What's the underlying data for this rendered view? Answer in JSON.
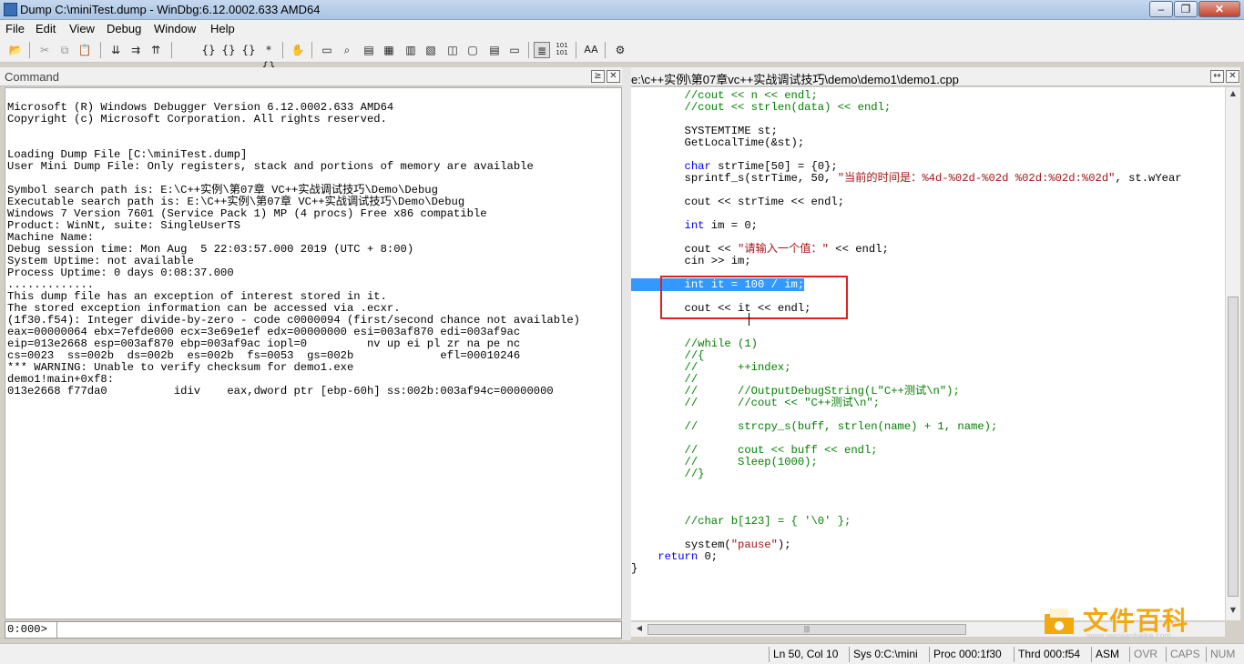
{
  "window": {
    "title": "Dump C:\\miniTest.dump - WinDbg:6.12.0002.633 AMD64",
    "min": "–",
    "max": "❐",
    "close": "✕"
  },
  "menu": [
    "File",
    "Edit",
    "View",
    "Debug",
    "Window",
    "Help"
  ],
  "toolbar": {
    "icons": [
      "open-icon",
      "cut-icon",
      "copy-icon",
      "paste-icon",
      "step-into-icon",
      "step-over-icon",
      "step-out-icon",
      "run-to-cursor-icon",
      "breakpoint-icon",
      "hand-icon",
      "command-window-icon",
      "watch-window-icon",
      "locals-window-icon",
      "registers-window-icon",
      "memory-window-icon",
      "call-stack-icon",
      "disassembly-icon",
      "scratch-pad-icon",
      "source-mode-icon",
      "hex-mode-icon",
      "font-icon",
      "options-icon"
    ],
    "hex_label": "101\n101",
    "font_label": "AA"
  },
  "command_pane": {
    "title": "Command",
    "lines": [
      "",
      "Microsoft (R) Windows Debugger Version 6.12.0002.633 AMD64",
      "Copyright (c) Microsoft Corporation. All rights reserved.",
      "",
      "",
      "Loading Dump File [C:\\miniTest.dump]",
      "User Mini Dump File: Only registers, stack and portions of memory are available",
      "",
      "Symbol search path is: E:\\C++实例\\第07章 VC++实战调试技巧\\Demo\\Debug",
      "Executable search path is: E:\\C++实例\\第07章 VC++实战调试技巧\\Demo\\Debug",
      "Windows 7 Version 7601 (Service Pack 1) MP (4 procs) Free x86 compatible",
      "Product: WinNt, suite: SingleUserTS",
      "Machine Name:",
      "Debug session time: Mon Aug  5 22:03:57.000 2019 (UTC + 8:00)",
      "System Uptime: not available",
      "Process Uptime: 0 days 0:08:37.000",
      ".............",
      "This dump file has an exception of interest stored in it.",
      "The stored exception information can be accessed via .ecxr.",
      "(1f30.f54): Integer divide-by-zero - code c0000094 (first/second chance not available)",
      "eax=00000064 ebx=7efde000 ecx=3e69e1ef edx=00000000 esi=003af870 edi=003af9ac",
      "eip=013e2668 esp=003af870 ebp=003af9ac iopl=0         nv up ei pl zr na pe nc",
      "cs=0023  ss=002b  ds=002b  es=002b  fs=0053  gs=002b             efl=00010246",
      "*** WARNING: Unable to verify checksum for demo1.exe",
      "demo1!main+0xf8:",
      "013e2668 f77da0          idiv    eax,dword ptr [ebp-60h] ss:002b:003af94c=00000000"
    ],
    "prompt": "0:000>",
    "input_value": ""
  },
  "source_pane": {
    "title": "e:\\c++实例\\第07章vc++实战调试技巧\\demo\\demo1\\demo1.cpp",
    "lines": [
      [
        {
          "t": "        "
        },
        {
          "t": "//cout << n << endl;",
          "c": "cm"
        }
      ],
      [
        {
          "t": "        "
        },
        {
          "t": "//cout << strlen(data) << endl;",
          "c": "cm"
        }
      ],
      [
        {
          "t": ""
        }
      ],
      [
        {
          "t": "        SYSTEMTIME st;"
        }
      ],
      [
        {
          "t": "        GetLocalTime(&st);"
        }
      ],
      [
        {
          "t": ""
        }
      ],
      [
        {
          "t": "        "
        },
        {
          "t": "char",
          "c": "kw"
        },
        {
          "t": " strTime[50] = {0};"
        }
      ],
      [
        {
          "t": "        sprintf_s(strTime, 50, "
        },
        {
          "t": "\"当前的时间是：%4d-%02d-%02d %02d:%02d:%02d\"",
          "c": "st"
        },
        {
          "t": ", st.wYear"
        }
      ],
      [
        {
          "t": ""
        }
      ],
      [
        {
          "t": "        cout << strTime << endl;"
        }
      ],
      [
        {
          "t": ""
        }
      ],
      [
        {
          "t": "        "
        },
        {
          "t": "int",
          "c": "kw"
        },
        {
          "t": " im = 0;"
        }
      ],
      [
        {
          "t": ""
        }
      ],
      [
        {
          "t": "        cout << "
        },
        {
          "t": "\"请输入一个值：\"",
          "c": "st"
        },
        {
          "t": " << endl;"
        }
      ],
      [
        {
          "t": "        cin >> im;"
        }
      ],
      [
        {
          "t": ""
        }
      ],
      [
        {
          "t": "        int it = 100 / im;",
          "c": "sel"
        }
      ],
      [
        {
          "t": ""
        }
      ],
      [
        {
          "t": "        cout << it << endl;"
        }
      ],
      [
        {
          "t": ""
        }
      ],
      [
        {
          "t": ""
        }
      ],
      [
        {
          "t": "        "
        },
        {
          "t": "//while (1)",
          "c": "cm"
        }
      ],
      [
        {
          "t": "        "
        },
        {
          "t": "//{",
          "c": "cm"
        }
      ],
      [
        {
          "t": "        "
        },
        {
          "t": "//      ++index;",
          "c": "cm"
        }
      ],
      [
        {
          "t": "        "
        },
        {
          "t": "//",
          "c": "cm"
        }
      ],
      [
        {
          "t": "        "
        },
        {
          "t": "//      //OutputDebugString(L\"C++测试\\n\");",
          "c": "cm"
        }
      ],
      [
        {
          "t": "        "
        },
        {
          "t": "//      //cout << \"C++测试\\n\";",
          "c": "cm"
        }
      ],
      [
        {
          "t": ""
        }
      ],
      [
        {
          "t": "        "
        },
        {
          "t": "//      strcpy_s(buff, strlen(name) + 1, name);",
          "c": "cm"
        }
      ],
      [
        {
          "t": ""
        }
      ],
      [
        {
          "t": "        "
        },
        {
          "t": "//      cout << buff << endl;",
          "c": "cm"
        }
      ],
      [
        {
          "t": "        "
        },
        {
          "t": "//      Sleep(1000);",
          "c": "cm"
        }
      ],
      [
        {
          "t": "        "
        },
        {
          "t": "//}",
          "c": "cm"
        }
      ],
      [
        {
          "t": ""
        }
      ],
      [
        {
          "t": ""
        }
      ],
      [
        {
          "t": ""
        }
      ],
      [
        {
          "t": "        "
        },
        {
          "t": "//char b[123] = { '\\0' };",
          "c": "cm"
        }
      ],
      [
        {
          "t": ""
        }
      ],
      [
        {
          "t": "        system("
        },
        {
          "t": "\"pause\"",
          "c": "st"
        },
        {
          "t": ");"
        }
      ],
      [
        {
          "t": "    "
        },
        {
          "t": "return",
          "c": "kw"
        },
        {
          "t": " 0;"
        }
      ],
      [
        {
          "t": "}"
        }
      ]
    ],
    "hscroll_grip": "|||"
  },
  "status": {
    "position": "Ln 50, Col 10",
    "sys": "Sys 0:C:\\mini",
    "proc": "Proc 000:1f30",
    "thrd": "Thrd 000:f54",
    "asm": "ASM",
    "ovr": "OVR",
    "caps": "CAPS",
    "num": "NUM"
  },
  "watermark": {
    "text": "文件百科",
    "url": "www.wenjianbaike.com"
  }
}
